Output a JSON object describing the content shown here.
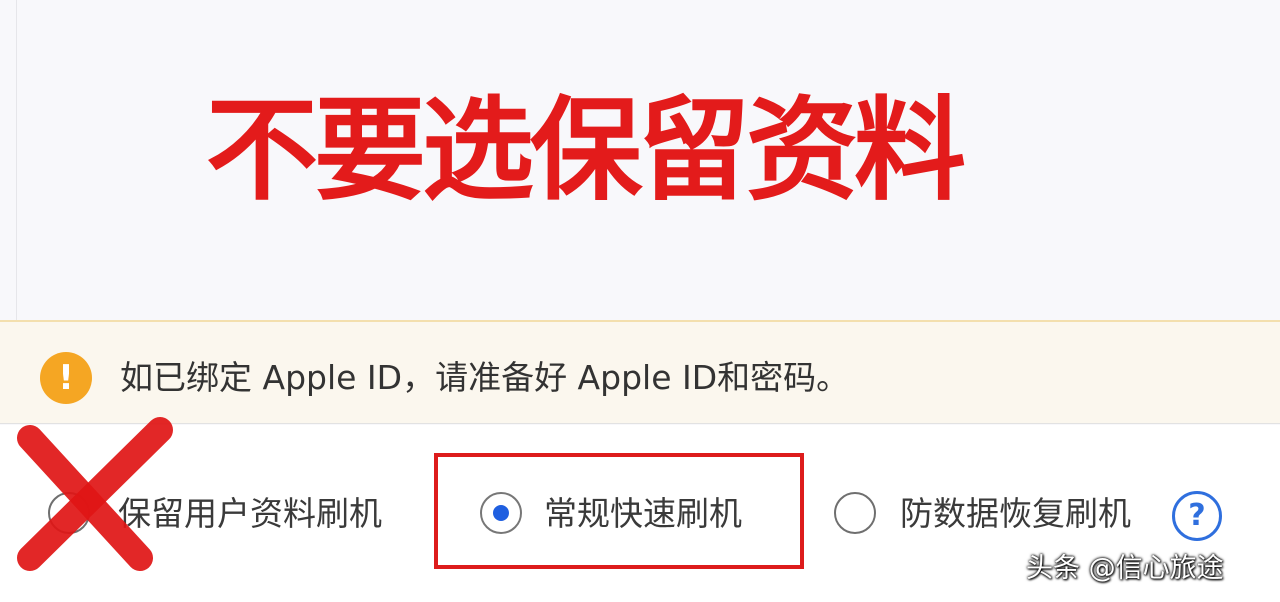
{
  "headline": "不要选保留资料",
  "notice": {
    "icon": "exclamation-icon",
    "icon_glyph": "!",
    "text": "如已绑定 Apple ID，请准备好 Apple ID和密码。"
  },
  "flash_modes": [
    {
      "label": "保留用户资料刷机",
      "selected": false
    },
    {
      "label": "常规快速刷机",
      "selected": true
    },
    {
      "label": "防数据恢复刷机",
      "selected": false
    }
  ],
  "help": {
    "icon": "question-icon",
    "glyph": "?"
  },
  "annotation": {
    "icon": "red-cross-mark-icon"
  },
  "watermark": "头条 @信心旅途",
  "colors": {
    "headline": "#e31b1b",
    "warning": "#f5a623",
    "radio_dot": "#1f5fe0",
    "highlight": "#dd1c1c",
    "help": "#2f6fde"
  }
}
